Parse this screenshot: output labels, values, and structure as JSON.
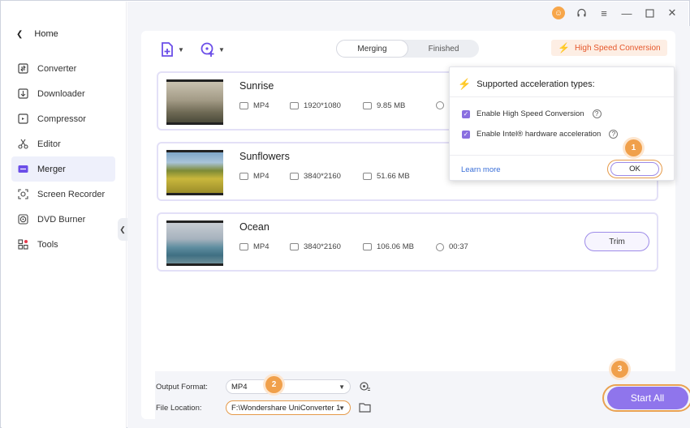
{
  "sidebar": {
    "home": "Home",
    "items": [
      {
        "label": "Converter",
        "icon": "converter-icon"
      },
      {
        "label": "Downloader",
        "icon": "downloader-icon"
      },
      {
        "label": "Compressor",
        "icon": "compressor-icon"
      },
      {
        "label": "Editor",
        "icon": "scissors-icon"
      },
      {
        "label": "Merger",
        "icon": "merger-icon",
        "active": true
      },
      {
        "label": "Screen Recorder",
        "icon": "screen-recorder-icon"
      },
      {
        "label": "DVD Burner",
        "icon": "disc-icon"
      },
      {
        "label": "Tools",
        "icon": "tools-grid-icon"
      }
    ]
  },
  "toolbar": {
    "tabs": [
      "Merging",
      "Finished"
    ],
    "active_tab": "Merging",
    "high_speed": "High Speed Conversion"
  },
  "files": [
    {
      "name": "Sunrise",
      "format": "MP4",
      "resolution": "1920*1080",
      "size": "9.85 MB",
      "duration": ""
    },
    {
      "name": "Sunflowers",
      "format": "MP4",
      "resolution": "3840*2160",
      "size": "51.66 MB",
      "duration": ""
    },
    {
      "name": "Ocean",
      "format": "MP4",
      "resolution": "3840*2160",
      "size": "106.06 MB",
      "duration": "00:37",
      "trim": "Trim"
    }
  ],
  "popup": {
    "title": "Supported acceleration types:",
    "option1": "Enable High Speed Conversion",
    "option2": "Enable Intel® hardware acceleration",
    "learn_more": "Learn more",
    "ok": "OK"
  },
  "steps": [
    "1",
    "2",
    "3"
  ],
  "bottom": {
    "output_format_label": "Output Format:",
    "output_format_value": "MP4",
    "file_location_label": "File Location:",
    "file_location_value": "F:\\Wondershare UniConverter 1",
    "start_all": "Start All"
  },
  "colors": {
    "accent": "#8f75ec",
    "highlight": "#f0a04b",
    "hsc": "#e5572b"
  }
}
